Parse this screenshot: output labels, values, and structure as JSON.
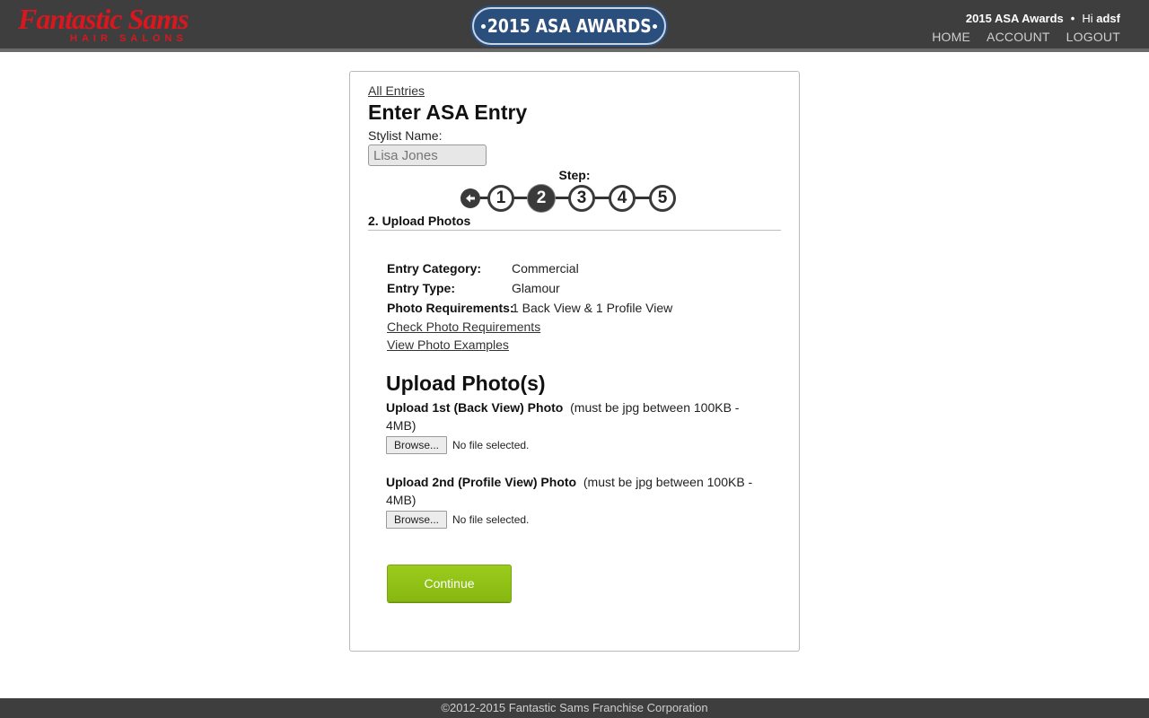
{
  "header": {
    "logo_text": "Fantastic Sams",
    "logo_subtext": "HAIR SALONS",
    "badge_text": "2015 ASA AWARDS",
    "site_name": "2015 ASA Awards",
    "separator": "•",
    "greeting": "Hi",
    "username": "adsf",
    "nav": [
      "HOME",
      "ACCOUNT",
      "LOGOUT"
    ]
  },
  "entry": {
    "all_entries_link": "All Entries",
    "title": "Enter ASA Entry",
    "stylist_label": "Stylist Name:",
    "stylist_placeholder": "Lisa Jones",
    "step_label": "Step:",
    "steps": [
      "1",
      "2",
      "3",
      "4",
      "5"
    ],
    "current_step": 2,
    "back_icon": "arrow-left-icon",
    "section_title": "2. Upload Photos",
    "details": [
      {
        "key": "Entry Category:",
        "value": "Commercial"
      },
      {
        "key": "Entry Type:",
        "value": "Glamour"
      },
      {
        "key": "Photo Requirements:",
        "value": "1 Back View & 1 Profile View"
      }
    ],
    "links": [
      "Check Photo Requirements",
      "View Photo Examples"
    ]
  },
  "upload": {
    "title": "Upload Photo(s)",
    "photo1_label": "Upload 1st (Back View) Photo",
    "photo1_note": "(must be jpg between 100KB - 4MB)",
    "photo2_label": "Upload 2nd (Profile View) Photo",
    "photo2_note": "(must be jpg between 100KB - 4MB)",
    "browse_label": "Browse...",
    "file_status": "No file selected.",
    "continue_label": "Continue"
  },
  "footer": {
    "copyright": "©2012-2015 Fantastic Sams Franchise Corporation"
  },
  "colors": {
    "header_bg": "#3e3e3e",
    "logo_red": "#d8171f",
    "badge_blue": "#2b4f7c",
    "continue_green": "#8dc014"
  }
}
